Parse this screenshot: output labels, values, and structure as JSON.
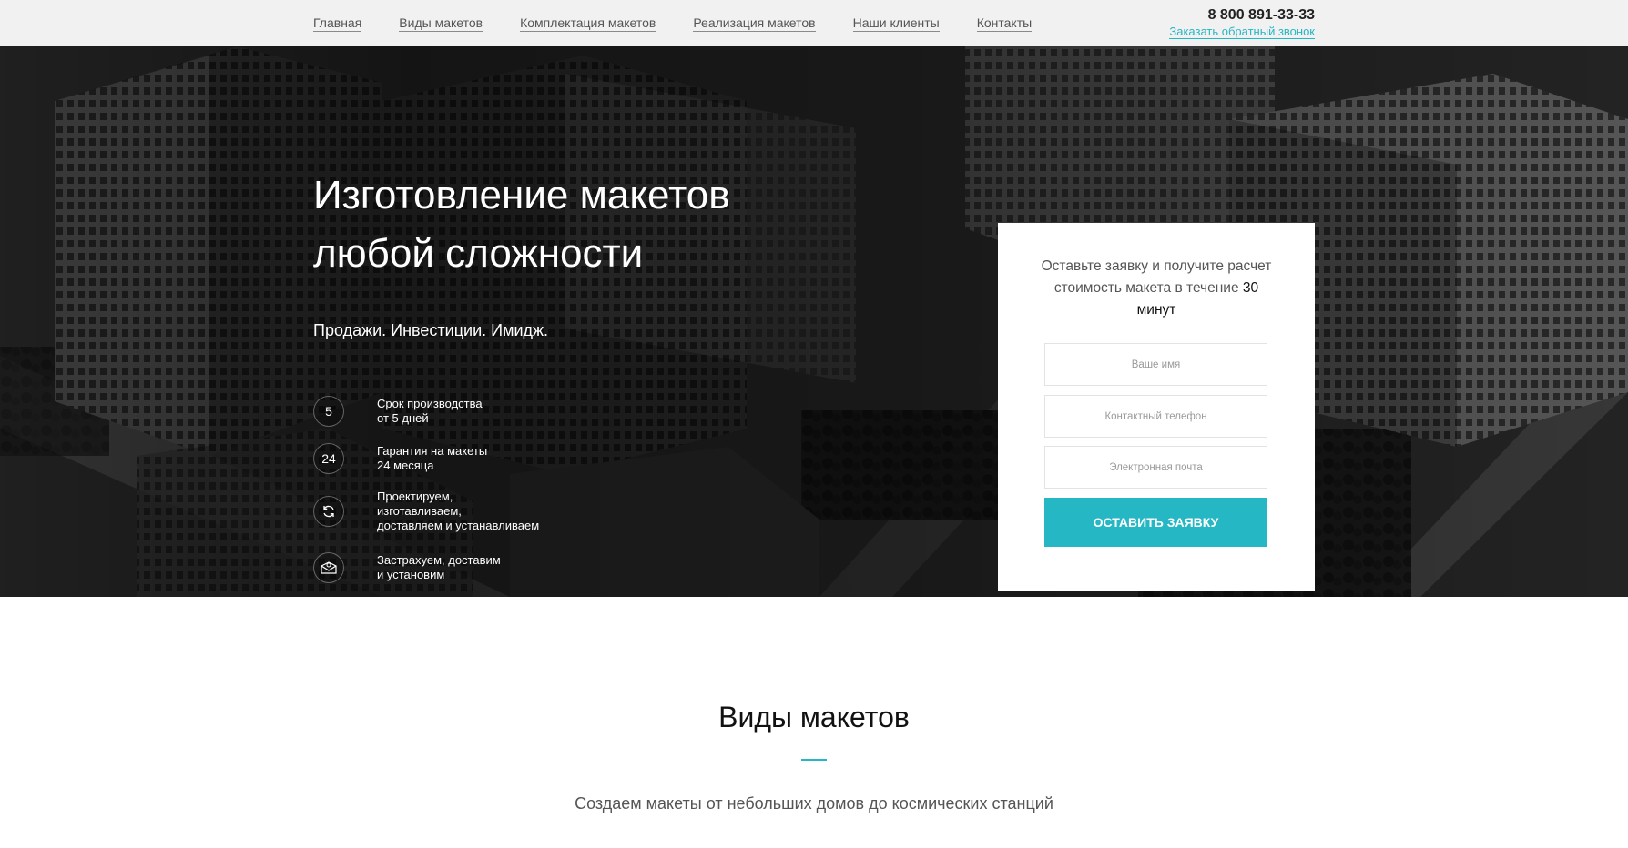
{
  "nav": {
    "items": [
      {
        "label": "Главная"
      },
      {
        "label": "Виды макетов"
      },
      {
        "label": "Комплектация макетов"
      },
      {
        "label": "Реализация макетов"
      },
      {
        "label": "Наши клиенты"
      },
      {
        "label": "Контакты"
      }
    ]
  },
  "header": {
    "phone": "8 800 891-33-33",
    "callback_label": "Заказать обратный звонок"
  },
  "hero": {
    "title": "Изготовление макетов любой сложности",
    "subtitle": "Продажи. Инвестиции. Имидж.",
    "features": [
      {
        "badge": "5",
        "text": "Срок производства\nот 5 дней"
      },
      {
        "badge": "24",
        "text": "Гарантия на макеты\n24 месяца"
      },
      {
        "icon": "refresh-icon",
        "text": "Проектируем,\nизготавливаем,\nдоставляем и устанавливаем"
      },
      {
        "icon": "insured-delivery-icon",
        "text": "Застрахуем, доставим\nи установим"
      }
    ]
  },
  "form": {
    "heading_text": "Оставьте заявку и получите расчет стоимость макета в течение",
    "heading_bold": "30 минут",
    "name_placeholder": "Ваше имя",
    "phone_placeholder": "Контактный телефон",
    "email_placeholder": "Электронная почта",
    "submit_label": "ОСТАВИТЬ ЗАЯВКУ"
  },
  "section": {
    "title": "Виды макетов",
    "subtitle": "Создаем макеты от небольших домов до космических станций"
  },
  "colors": {
    "accent": "#25b7c3",
    "topbar_bg": "#f1f1f1",
    "hero_bg": "#1c1c1c"
  }
}
